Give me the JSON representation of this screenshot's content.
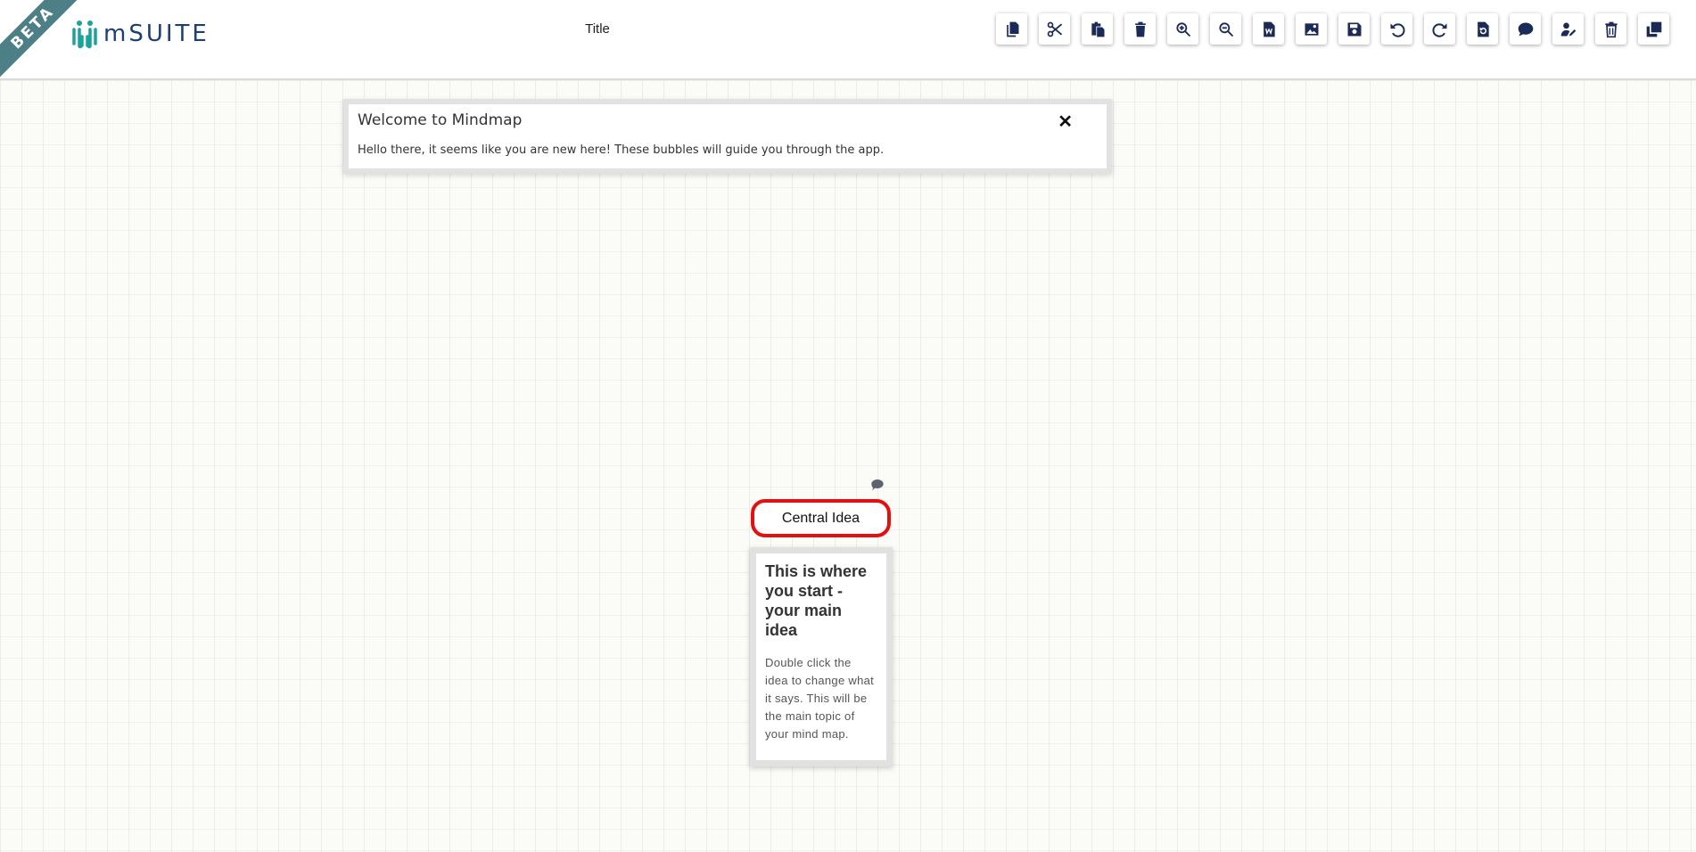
{
  "header": {
    "beta_label": "BETA",
    "logo_text": "mSUITE",
    "page_title": "Title"
  },
  "toolbar": {
    "items": [
      {
        "name": "copy",
        "icon": "copy-icon"
      },
      {
        "name": "cut",
        "icon": "scissors-icon"
      },
      {
        "name": "paste",
        "icon": "paste-icon"
      },
      {
        "name": "delete",
        "icon": "trash-icon"
      },
      {
        "name": "zoom-in",
        "icon": "zoom-in-icon"
      },
      {
        "name": "zoom-out",
        "icon": "zoom-out-icon"
      },
      {
        "name": "export-word",
        "icon": "word-file-icon"
      },
      {
        "name": "export-image",
        "icon": "image-icon"
      },
      {
        "name": "save",
        "icon": "save-icon"
      },
      {
        "name": "undo",
        "icon": "undo-icon"
      },
      {
        "name": "redo",
        "icon": "redo-icon"
      },
      {
        "name": "reload-file",
        "icon": "file-reload-icon"
      },
      {
        "name": "comment",
        "icon": "comment-icon"
      },
      {
        "name": "edit-user",
        "icon": "user-edit-icon"
      },
      {
        "name": "delete-all",
        "icon": "trash-all-icon"
      },
      {
        "name": "duplicate",
        "icon": "clone-icon"
      }
    ],
    "icon_color": "#1c2a57"
  },
  "welcome": {
    "title": "Welcome to Mindmap",
    "body": "Hello there, it seems like you are new here! These bubbles will guide you through the app.",
    "close": "✕"
  },
  "mindmap": {
    "central_node_label": "Central Idea",
    "node_border_color": "#e41010"
  },
  "tip": {
    "title": "This is where you start - your main idea",
    "body": "Double click the idea to change what it says. This will be the main topic of your mind map."
  },
  "colors": {
    "brand": "#1c3f74",
    "logo_mark": "#1aa39a",
    "beta_ribbon": "#4d7f87"
  }
}
